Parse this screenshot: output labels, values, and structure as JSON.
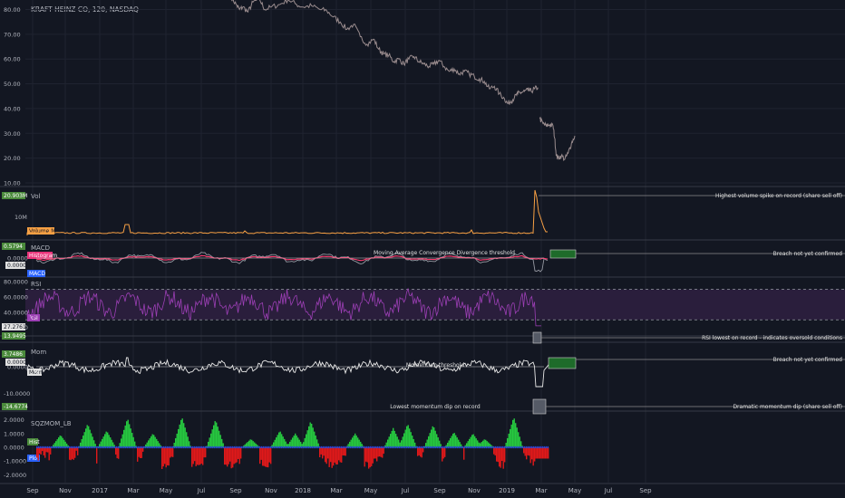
{
  "window": {
    "symbol_label": "KRAFT HEINZ CO, 120, NASDAQ"
  },
  "colors": {
    "background": "#131722",
    "grid": "#1f2330",
    "separator": "#363a45",
    "axis_text": "#b2b5be",
    "price_line": "#9a8c8e",
    "volume": "#f7a044",
    "macd": "#9598a1",
    "macd_hist": "#ff3b6f",
    "rsi": "#9c3fb5",
    "rsi_band": "#2a1e3c",
    "mom": "#e8e8e8",
    "sqz_up": "#26c940",
    "sqz_down": "#e0191a",
    "sqz_dots": "#2848d8",
    "annotation_line": "#8c8c8c",
    "box_green": "#1e6b2a",
    "label_green": "#4a8a3b",
    "label_orange": "#f7a044",
    "label_pink": "#e9337a",
    "label_blue": "#2962ff",
    "label_purple": "#9c3fb5"
  },
  "chart_data": [
    {
      "type": "line",
      "name": "price",
      "x_axis": {
        "tick_labels": [
          "Sep",
          "Nov",
          "2017",
          "Mar",
          "May",
          "Jul",
          "Sep",
          "Nov",
          "2018",
          "Mar",
          "May",
          "Jul",
          "Sep",
          "Nov",
          "2019",
          "Mar",
          "May",
          "Jul",
          "Sep"
        ]
      },
      "y_ticks": [
        "80.00",
        "70.00",
        "60.00",
        "50.00",
        "40.00",
        "30.00",
        "20.00",
        "10.00"
      ],
      "ylim": [
        10,
        82
      ],
      "segments": [
        {
          "x": [
            2018.85,
            2019.0,
            2019.1,
            2019.2,
            2019.35,
            2019.5,
            2019.7,
            2019.85,
            2020.05,
            2020.3,
            2020.55,
            2020.8,
            2021.0,
            2021.25,
            2021.5,
            2021.7,
            2021.9,
            2022.1,
            2022.3,
            2022.5,
            2022.7,
            2022.9,
            2023.1,
            2023.25,
            2023.4,
            2023.55,
            2023.7,
            2023.85,
            2024.0,
            2024.15,
            2024.3,
            2024.45,
            2024.6,
            2024.75,
            2024.9,
            2025.05,
            2025.2,
            2025.35,
            2025.5,
            2025.65,
            2025.8,
            2025.95,
            2026.1,
            2026.25,
            2026.4,
            2026.55,
            2026.7,
            2026.85,
            2027.0
          ],
          "y": [
            85,
            82,
            80,
            81,
            79,
            83,
            84,
            80,
            81,
            82,
            84,
            82,
            81,
            81.5,
            80,
            79.5,
            77,
            75,
            72,
            74,
            69,
            66,
            68,
            64,
            62,
            61.5,
            59,
            60,
            58,
            60,
            61,
            59,
            58,
            57,
            58,
            59.5,
            57,
            55,
            56,
            54,
            55,
            54,
            53,
            52,
            51,
            48,
            49,
            46,
            44
          ]
        },
        {
          "x": [
            2027.0,
            2027.1,
            2027.2,
            2027.3,
            2027.4,
            2027.5,
            2027.6,
            2027.7,
            2027.8,
            2027.9,
            2028.0
          ],
          "y": [
            44,
            42,
            43,
            44.5,
            46,
            46.5,
            47,
            47.5,
            47,
            48,
            48.5
          ]
        },
        {
          "x": [
            2028.05,
            2028.15,
            2028.25,
            2028.35,
            2028.45
          ],
          "y": [
            36,
            34,
            33,
            33.5,
            33
          ]
        },
        {
          "x": [
            2028.45,
            2028.5,
            2028.55,
            2028.6,
            2028.7,
            2028.8,
            2028.9,
            2029.0,
            2029.1
          ],
          "y": [
            33,
            28,
            21,
            20,
            21,
            19.5,
            22,
            26,
            29
          ]
        }
      ]
    },
    {
      "type": "area",
      "name": "volume",
      "label": "Vol",
      "y_ticks": [
        "10M"
      ],
      "value_label": "20.903M",
      "series_label": "Volume MA",
      "annotation": "Highest volume spike on record (share sell off)"
    },
    {
      "type": "line",
      "name": "macd",
      "label": "MACD",
      "y_ticks": [
        "0.0000"
      ],
      "value_labels": [
        "0.5794",
        "Histogram",
        "0.0000",
        "MACD"
      ],
      "annotations": [
        "Moving Average Convergence Divergence threshold",
        "Breach not yet confirmed"
      ]
    },
    {
      "type": "line",
      "name": "rsi",
      "label": "RSI",
      "y_ticks": [
        "80.0000",
        "60.0000",
        "40.0000",
        "20.0000"
      ],
      "ylim": [
        10,
        85
      ],
      "upper_band": 70,
      "lower_band": 30,
      "value_labels": [
        "RSI",
        "27.2761",
        "13.9495"
      ],
      "annotation": "RSI lowest on record - indicates oversold conditions"
    },
    {
      "type": "line",
      "name": "momentum",
      "label": "Mom",
      "y_ticks": [
        "0.0000",
        "-10.0000"
      ],
      "value_labels": [
        "3.7486",
        "0.0000",
        "Mom",
        "-14.6774"
      ],
      "annotations": [
        "Momentum threshold",
        "Breach not yet confirmed",
        "Lowest momentum dip on record",
        "Dramatic momentum dip (share sell off)"
      ]
    },
    {
      "type": "bar",
      "name": "sqzmom",
      "label": "SQZMOM_LB",
      "y_ticks": [
        "2.0000",
        "1.0000",
        "0.0000",
        "-1.0000",
        "-2.0000"
      ],
      "ylim": [
        -2.3,
        2.3
      ],
      "value_labels": [
        "Hist",
        "Plot"
      ]
    }
  ]
}
